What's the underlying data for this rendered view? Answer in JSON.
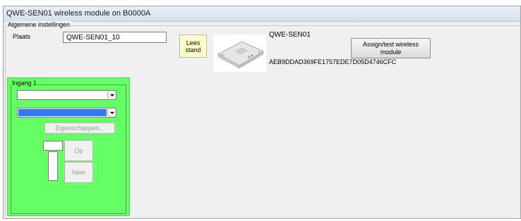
{
  "window": {
    "title": "QWE-SEN01 wireless module on B0000A"
  },
  "general": {
    "legend": "Algemene instellingen",
    "plaats_label": "Plaats",
    "plaats_value": "QWE-SEN01_10",
    "lees_stand_line1": "Lees",
    "lees_stand_line2": "stand",
    "device_name": "QWE-SEN01",
    "device_id": "AEB9DDAD369FE1757EDE7D05D4746CFC",
    "assign_line1": "Assign/test wireless",
    "assign_line2": "module",
    "device_image_icon": "sensor-module-image"
  },
  "ingang": {
    "legend": "Ingang 1",
    "combo1_value": "",
    "combo2_value": "",
    "eigenschappen_label": "Eigenschappen...",
    "op_label": "Op",
    "neer_label": "Neer",
    "panel_color": "#66ff66",
    "selected_color": "#3377ff"
  }
}
